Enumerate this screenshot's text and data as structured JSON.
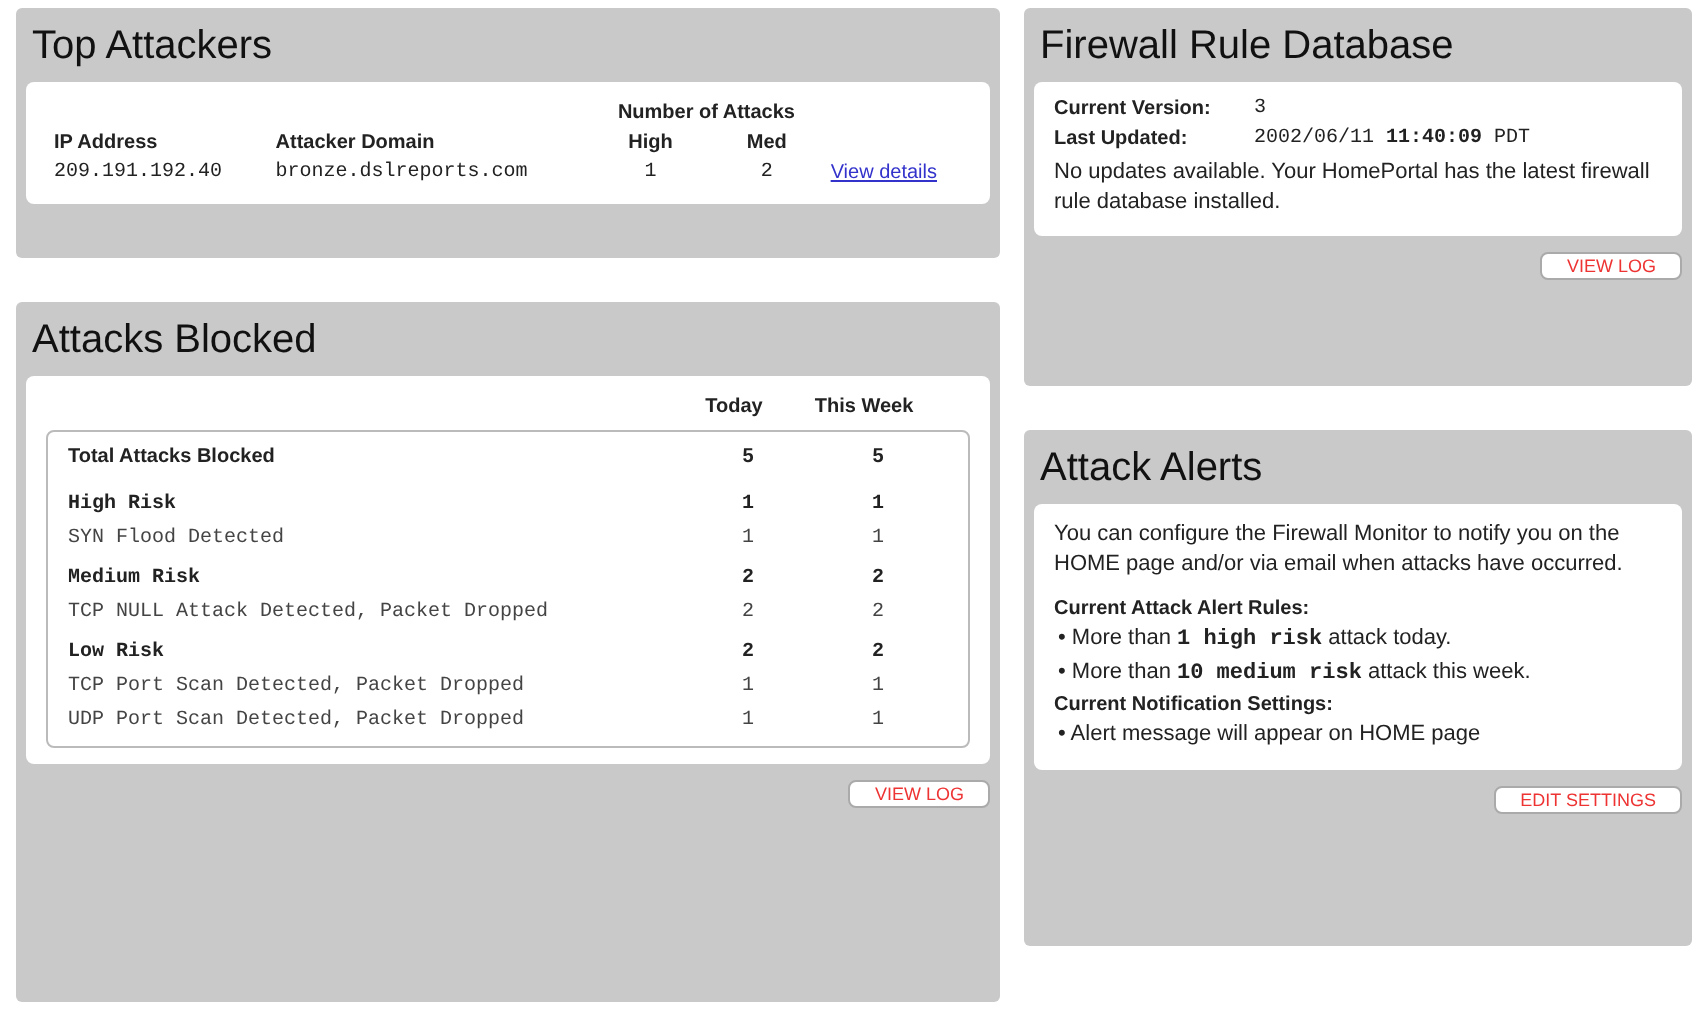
{
  "top_attackers": {
    "title": "Top Attackers",
    "group_heading": "Number of Attacks",
    "columns": [
      "IP Address",
      "Attacker Domain",
      "High",
      "Med"
    ],
    "rows": [
      {
        "ip": "209.191.192.40",
        "domain": "bronze.dslreports.com",
        "high": "1",
        "med": "2",
        "link": "View details"
      }
    ]
  },
  "attacks_blocked": {
    "title": "Attacks Blocked",
    "columns": [
      "Today",
      "This Week"
    ],
    "rows": [
      {
        "kind": "total",
        "label": "Total Attacks Blocked",
        "today": "5",
        "week": "5"
      },
      {
        "kind": "group",
        "label": "High Risk",
        "today": "1",
        "week": "1"
      },
      {
        "kind": "item",
        "label": "SYN Flood Detected",
        "today": "1",
        "week": "1"
      },
      {
        "kind": "group",
        "label": "Medium Risk",
        "today": "2",
        "week": "2"
      },
      {
        "kind": "item",
        "label": "TCP NULL Attack Detected, Packet Dropped",
        "today": "2",
        "week": "2"
      },
      {
        "kind": "group",
        "label": "Low Risk",
        "today": "2",
        "week": "2"
      },
      {
        "kind": "item",
        "label": "TCP Port Scan Detected, Packet Dropped",
        "today": "1",
        "week": "1"
      },
      {
        "kind": "item",
        "label": "UDP Port Scan Detected, Packet Dropped",
        "today": "1",
        "week": "1"
      }
    ],
    "button": "VIEW LOG"
  },
  "firewall_rule_database": {
    "title": "Firewall Rule Database",
    "fields": [
      {
        "label": "Current Version:",
        "value": "3"
      },
      {
        "label": "Last Updated:",
        "value": "2002/06/11 **11:40:09** PDT"
      }
    ],
    "message": "No updates available. Your HomePortal has the latest firewall rule database installed.",
    "button": "VIEW LOG"
  },
  "attack_alerts": {
    "title": "Attack Alerts",
    "intro": "You can configure the Firewall Monitor to notify you on the HOME page and/or via email when attacks have occurred.",
    "sections": [
      {
        "heading": "Current Attack Alert Rules:",
        "items": [
          "• More than **1 high risk** attack today.",
          "• More than **10 medium risk** attack this week."
        ]
      },
      {
        "heading": "Current Notification Settings:",
        "items": [
          "• Alert message will appear on HOME page"
        ]
      }
    ],
    "button": "EDIT SETTINGS"
  }
}
